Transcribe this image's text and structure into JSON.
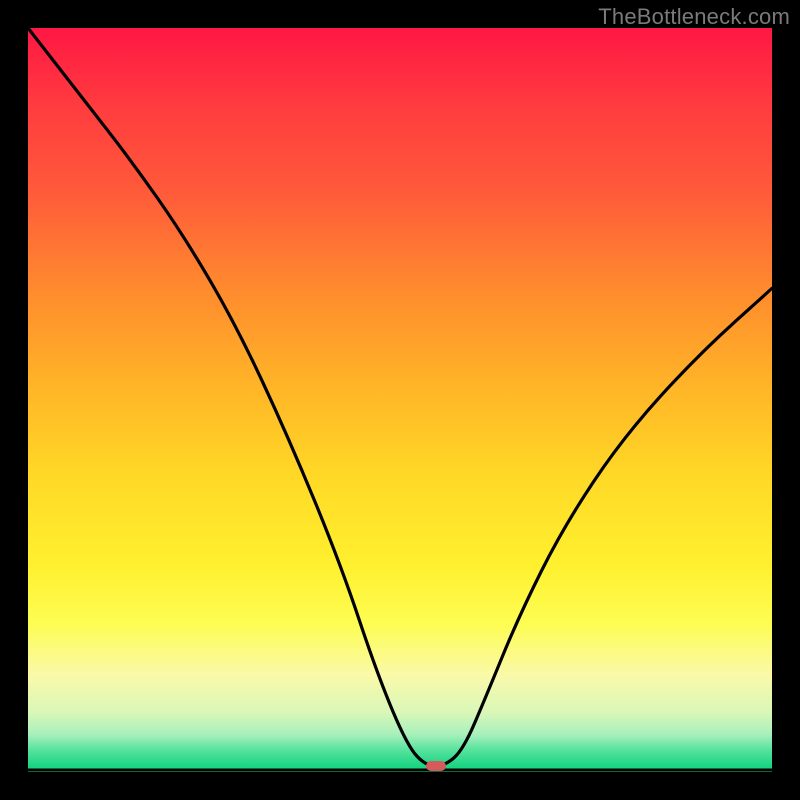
{
  "attribution": "TheBottleneck.com",
  "chart_data": {
    "type": "line",
    "title": "",
    "xlabel": "",
    "ylabel": "",
    "xlim": [
      0,
      1
    ],
    "ylim": [
      0,
      1
    ],
    "grid": false,
    "legend": false,
    "series": [
      {
        "name": "curve",
        "x": [
          0.0,
          0.07,
          0.14,
          0.21,
          0.28,
          0.35,
          0.42,
          0.47,
          0.51,
          0.535,
          0.56,
          0.585,
          0.615,
          0.66,
          0.72,
          0.8,
          0.9,
          1.0
        ],
        "y": [
          1.0,
          0.91,
          0.82,
          0.72,
          0.6,
          0.45,
          0.28,
          0.13,
          0.035,
          0.008,
          0.008,
          0.03,
          0.1,
          0.21,
          0.33,
          0.45,
          0.56,
          0.65
        ]
      }
    ],
    "min_marker": {
      "x": 0.548,
      "y": 0.008,
      "color": "#d65a5a"
    },
    "background_gradient": {
      "stops": [
        {
          "pos": 0.0,
          "color": "#ff1744"
        },
        {
          "pos": 0.35,
          "color": "#ff8a2e"
        },
        {
          "pos": 0.6,
          "color": "#ffd826"
        },
        {
          "pos": 0.8,
          "color": "#fdfd52"
        },
        {
          "pos": 0.95,
          "color": "#a6f0bc"
        },
        {
          "pos": 1.0,
          "color": "#0fd07a"
        }
      ]
    }
  }
}
